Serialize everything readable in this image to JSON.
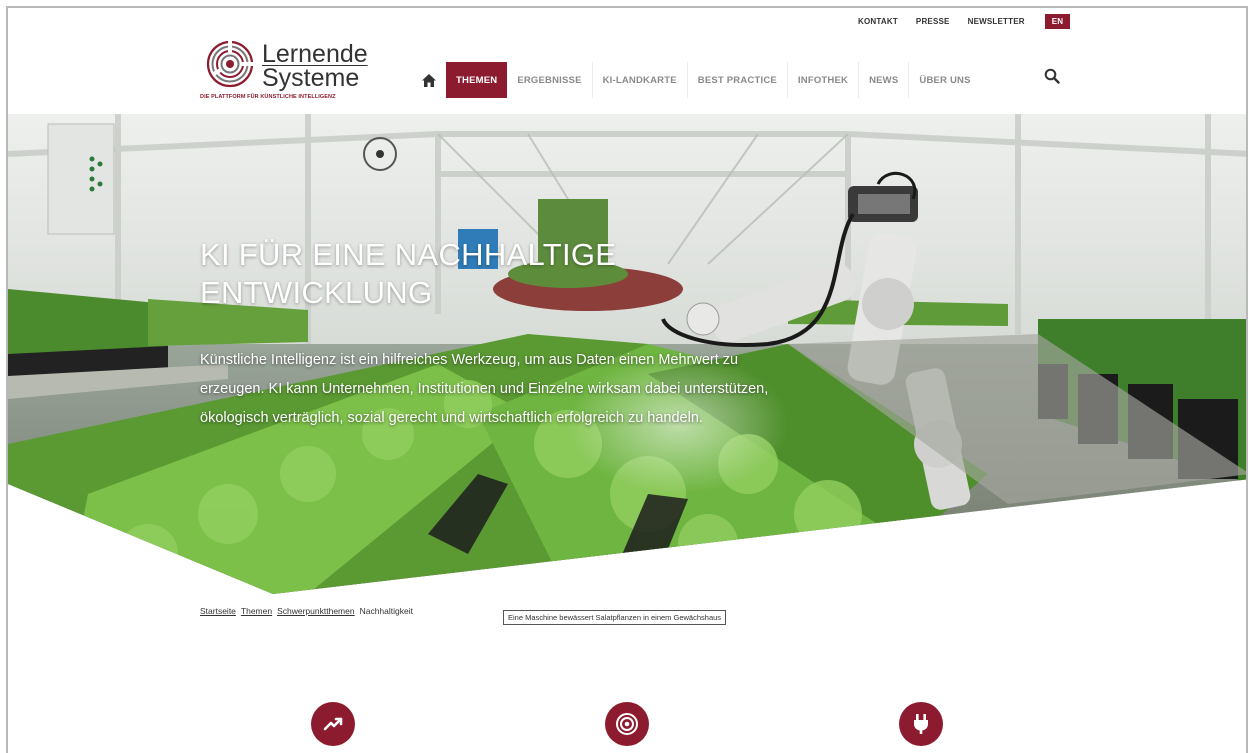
{
  "utility_nav": {
    "items": [
      "KONTAKT",
      "PRESSE",
      "NEWSLETTER"
    ],
    "language": "EN"
  },
  "logo": {
    "line1": "Lernende",
    "line2": "Systeme",
    "tagline": "DIE PLATTFORM FÜR KÜNSTLICHE INTELLIGENZ"
  },
  "main_nav": {
    "home_icon": "home-icon",
    "items": [
      "THEMEN",
      "ERGEBNISSE",
      "KI-LANDKARTE",
      "BEST PRACTICE",
      "INFOTHEK",
      "NEWS",
      "ÜBER UNS"
    ],
    "active": "THEMEN",
    "search_icon": "search-icon"
  },
  "hero": {
    "title_line1": "KI FÜR EINE NACHHALTIGE",
    "title_line2": "ENTWICKLUNG",
    "text": "Künstliche Intelligenz ist ein hilfreiches Werkzeug, um aus Daten einen Mehrwert zu erzeugen. KI kann Unternehmen, Institutionen und Einzelne wirksam dabei unterstützen, ökologisch verträglich, sozial gerecht und wirtschaftlich erfolgreich zu handeln."
  },
  "breadcrumb": {
    "items": [
      "Startseite",
      "Themen",
      "Schwerpunktthemen"
    ],
    "current": "Nachhaltigkeit"
  },
  "image_caption": "Eine Maschine bewässert Salatpflanzen in einem Gewächshaus",
  "features": {
    "icons": [
      "trending-up-icon",
      "target-icon",
      "power-plug-icon"
    ]
  },
  "colors": {
    "brand": "#8c1b30",
    "nav_text": "#8a8a8a"
  }
}
